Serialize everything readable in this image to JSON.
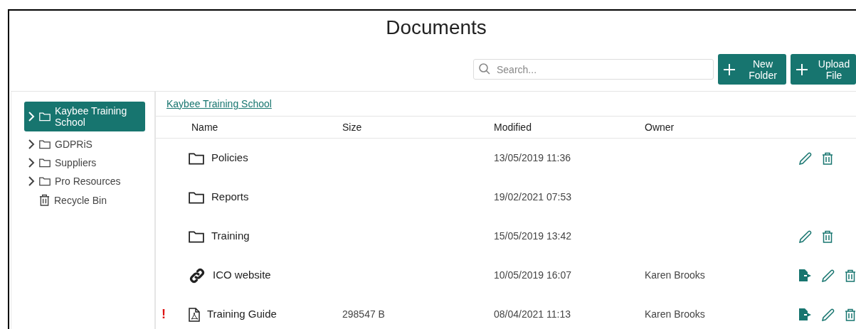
{
  "title": "Documents",
  "search": {
    "placeholder": "Search..."
  },
  "buttons": [
    {
      "label": "New Folder"
    },
    {
      "label": "Upload File"
    }
  ],
  "tree": [
    {
      "label": "Kaybee Training School",
      "kind": "folder",
      "selected": true,
      "expandable": true
    },
    {
      "label": "GDPRiS",
      "kind": "folder",
      "selected": false,
      "expandable": true
    },
    {
      "label": "Suppliers",
      "kind": "folder",
      "selected": false,
      "expandable": true
    },
    {
      "label": "Pro Resources",
      "kind": "folder",
      "selected": false,
      "expandable": true
    },
    {
      "label": "Recycle Bin",
      "kind": "bin",
      "selected": false,
      "expandable": false
    }
  ],
  "breadcrumb": "Kaybee Training School",
  "table": {
    "columns": [
      "Name",
      "Size",
      "Modified",
      "Owner"
    ],
    "rows": [
      {
        "kind": "folder",
        "name": "Policies",
        "modified": "13/05/2019 11:36",
        "export": false,
        "edit": true,
        "delete": true
      },
      {
        "kind": "folder",
        "name": "Reports",
        "modified": "19/02/2021 07:53",
        "export": false,
        "edit": false,
        "delete": false
      },
      {
        "kind": "folder",
        "name": "Training",
        "modified": "15/05/2019 13:42",
        "export": false,
        "edit": true,
        "delete": true
      },
      {
        "kind": "link",
        "name": "ICO website",
        "modified": "10/05/2019 16:07",
        "owner": "Karen Brooks",
        "export": true,
        "edit": true,
        "delete": true
      },
      {
        "kind": "pdf",
        "name": "Training Guide",
        "size": "298547 B",
        "modified": "08/04/2021 11:13",
        "owner": "Karen Brooks",
        "warning": "!",
        "export": true,
        "edit": true,
        "delete": true
      }
    ]
  }
}
